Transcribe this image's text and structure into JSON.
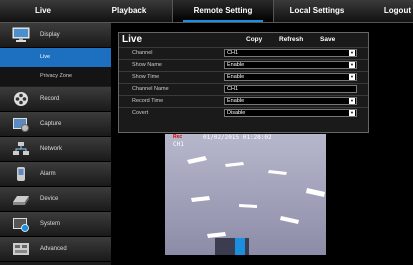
{
  "nav": {
    "tabs": [
      {
        "label": "Live"
      },
      {
        "label": "Playback"
      },
      {
        "label": "Remote Setting"
      },
      {
        "label": "Local Settings"
      },
      {
        "label": "Logout"
      }
    ],
    "active_index": 2
  },
  "sidebar": {
    "items": [
      {
        "label": "Display",
        "icon": "monitor-icon"
      },
      {
        "label": "Record",
        "icon": "film-reel-icon"
      },
      {
        "label": "Capture",
        "icon": "capture-icon"
      },
      {
        "label": "Network",
        "icon": "network-icon"
      },
      {
        "label": "Alarm",
        "icon": "alarm-icon"
      },
      {
        "label": "Device",
        "icon": "hard-drive-icon"
      },
      {
        "label": "System",
        "icon": "system-icon"
      },
      {
        "label": "Advanced",
        "icon": "advanced-icon"
      }
    ],
    "subitems": [
      {
        "label": "Live",
        "active": true
      },
      {
        "label": "Privacy Zone",
        "active": false
      }
    ]
  },
  "panel": {
    "title": "Live",
    "buttons": {
      "copy": "Copy",
      "refresh": "Refresh",
      "save": "Save"
    },
    "rows": [
      {
        "label": "Channel",
        "value": "CH1",
        "type": "select"
      },
      {
        "label": "Show Name",
        "value": "Enable",
        "type": "select"
      },
      {
        "label": "Show Time",
        "value": "Enable",
        "type": "select"
      },
      {
        "label": "Channel Name",
        "value": "CH1",
        "type": "text"
      },
      {
        "label": "Record Time",
        "value": "Enable",
        "type": "select"
      },
      {
        "label": "Covert",
        "value": "Disable",
        "type": "select"
      }
    ]
  },
  "video": {
    "channel_label": "CH1",
    "datetime": "01/02/2015 01:28:02",
    "rec_label": "Rec"
  },
  "colors": {
    "accent": "#1d6fbf",
    "highlight": "#1a8fe0"
  }
}
